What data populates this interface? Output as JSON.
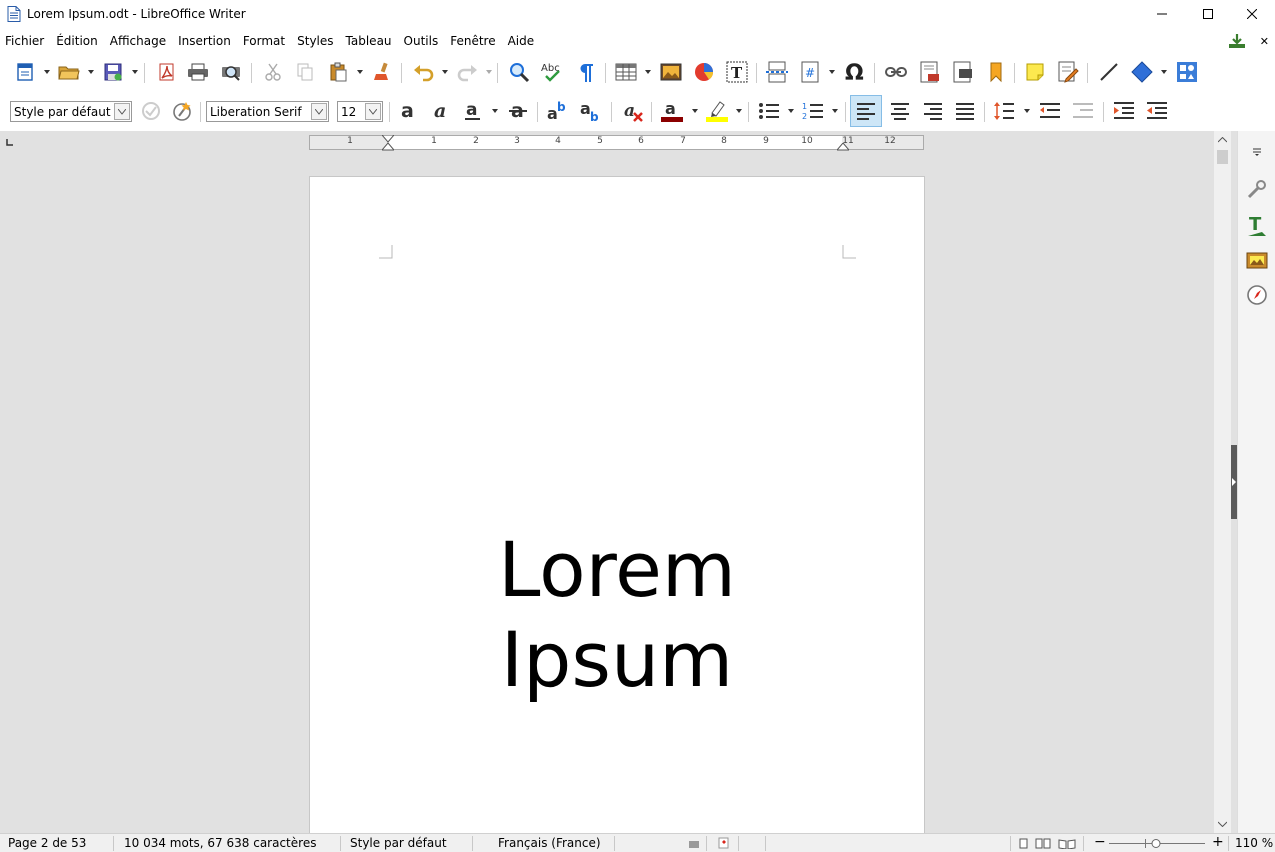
{
  "window": {
    "title": "Lorem Ipsum.odt - LibreOffice Writer",
    "minimize_glyph": "—",
    "maximize_glyph": "☐",
    "close_glyph": "✕"
  },
  "menu": {
    "items": [
      "Fichier",
      "Édition",
      "Affichage",
      "Insertion",
      "Format",
      "Styles",
      "Tableau",
      "Outils",
      "Fenêtre",
      "Aide"
    ],
    "close_doc_glyph": "✕"
  },
  "format_toolbar": {
    "paragraph_style": "Style par défaut",
    "font_name": "Liberation Serif",
    "font_size": "12"
  },
  "ruler": {
    "numbers": [
      "1",
      "1",
      "2",
      "3",
      "4",
      "5",
      "6",
      "7",
      "8",
      "9",
      "10",
      "11",
      "12"
    ]
  },
  "document": {
    "line1": "Lorem",
    "line2": "Ipsum"
  },
  "statusbar": {
    "page": "Page 2 de 53",
    "word_count": "10 034 mots, 67 638 caractères",
    "page_style": "Style par défaut",
    "language": "Français (France)",
    "zoom_label": "110 %"
  },
  "colors": {
    "font_color": "#8b0000",
    "highlight_color": "#ffff00",
    "accent": "#1e6fd9",
    "active_button_bg": "#cde6f7"
  }
}
